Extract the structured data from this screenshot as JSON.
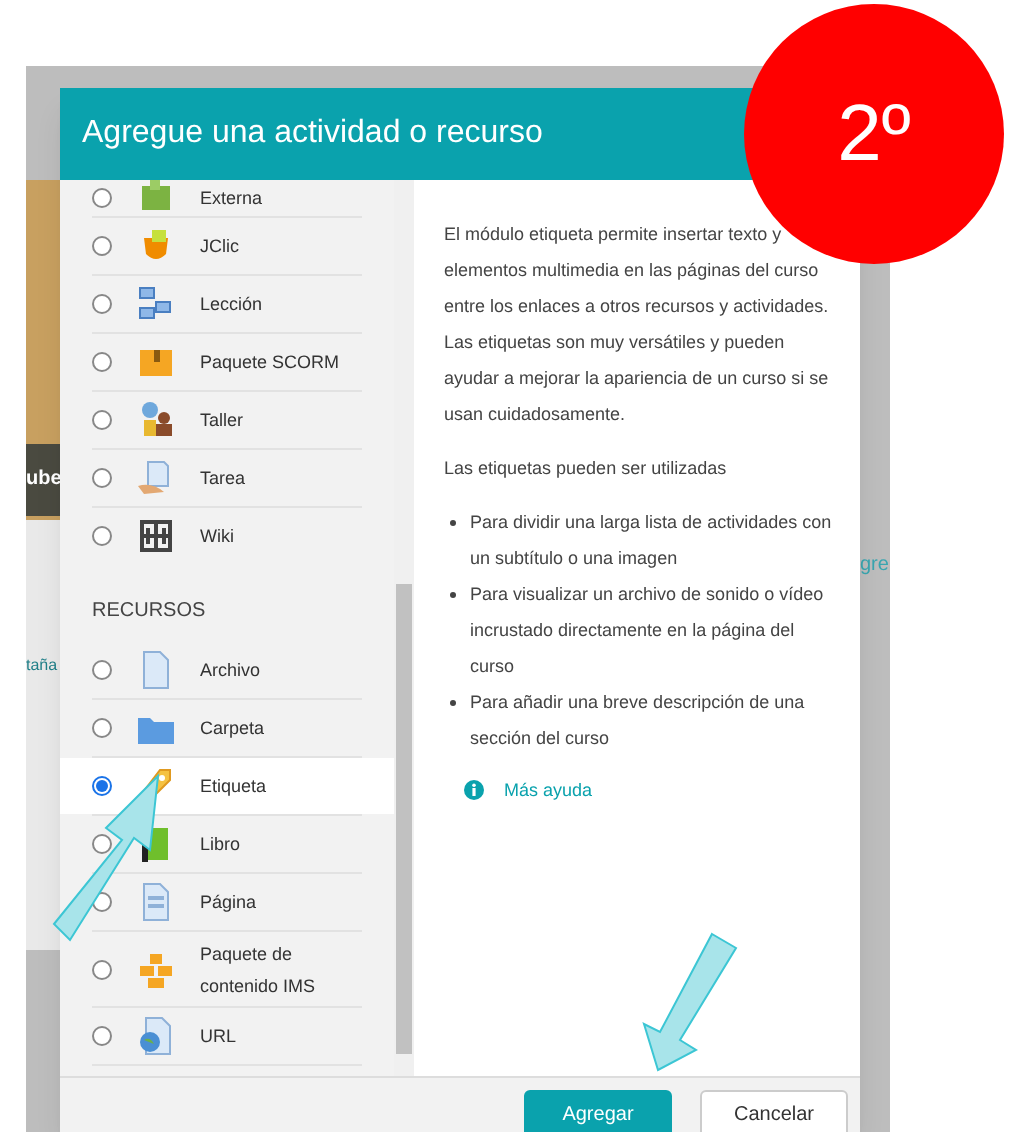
{
  "background": {
    "fragments": [
      {
        "kind": "banner",
        "text": "ube"
      },
      {
        "kind": "link",
        "text": "taña"
      },
      {
        "kind": "link_right",
        "text": "gre"
      }
    ]
  },
  "dialog": {
    "title": "Agregue una actividad o recurso",
    "sections": [
      {
        "items": [
          {
            "label": "Externa",
            "selected": false
          },
          {
            "label": "JClic",
            "selected": false
          },
          {
            "label": "Lección",
            "selected": false
          },
          {
            "label": "Paquete SCORM",
            "selected": false
          },
          {
            "label": "Taller",
            "selected": false
          },
          {
            "label": "Tarea",
            "selected": false
          },
          {
            "label": "Wiki",
            "selected": false
          }
        ]
      },
      {
        "heading": "RECURSOS",
        "items": [
          {
            "label": "Archivo",
            "selected": false
          },
          {
            "label": "Carpeta",
            "selected": false
          },
          {
            "label": "Etiqueta",
            "selected": true
          },
          {
            "label": "Libro",
            "selected": false
          },
          {
            "label": "Página",
            "selected": false
          },
          {
            "label": "Paquete de contenido IMS",
            "selected": false
          },
          {
            "label": "URL",
            "selected": false
          }
        ]
      }
    ],
    "description": {
      "paragraphs": [
        "El módulo etiqueta permite insertar texto y elementos multimedia en las páginas del curso entre los enlaces a otros recursos y actividades. Las etiquetas son muy versátiles y pueden ayudar a mejorar la apariencia de un curso si se usan cuidadosamente.",
        "Las etiquetas pueden ser utilizadas"
      ],
      "bullets": [
        "Para dividir una larga lista de actividades con un subtítulo o una imagen",
        "Para visualizar un archivo de sonido o vídeo incrustado directamente en la página del curso",
        "Para añadir una breve descripción de una sección del curso"
      ],
      "help_link": "Más ayuda"
    },
    "buttons": [
      {
        "label": "Agregar",
        "kind": "primary"
      },
      {
        "label": "Cancelar",
        "kind": "secondary"
      }
    ]
  },
  "step_badge": {
    "text": "2º"
  }
}
